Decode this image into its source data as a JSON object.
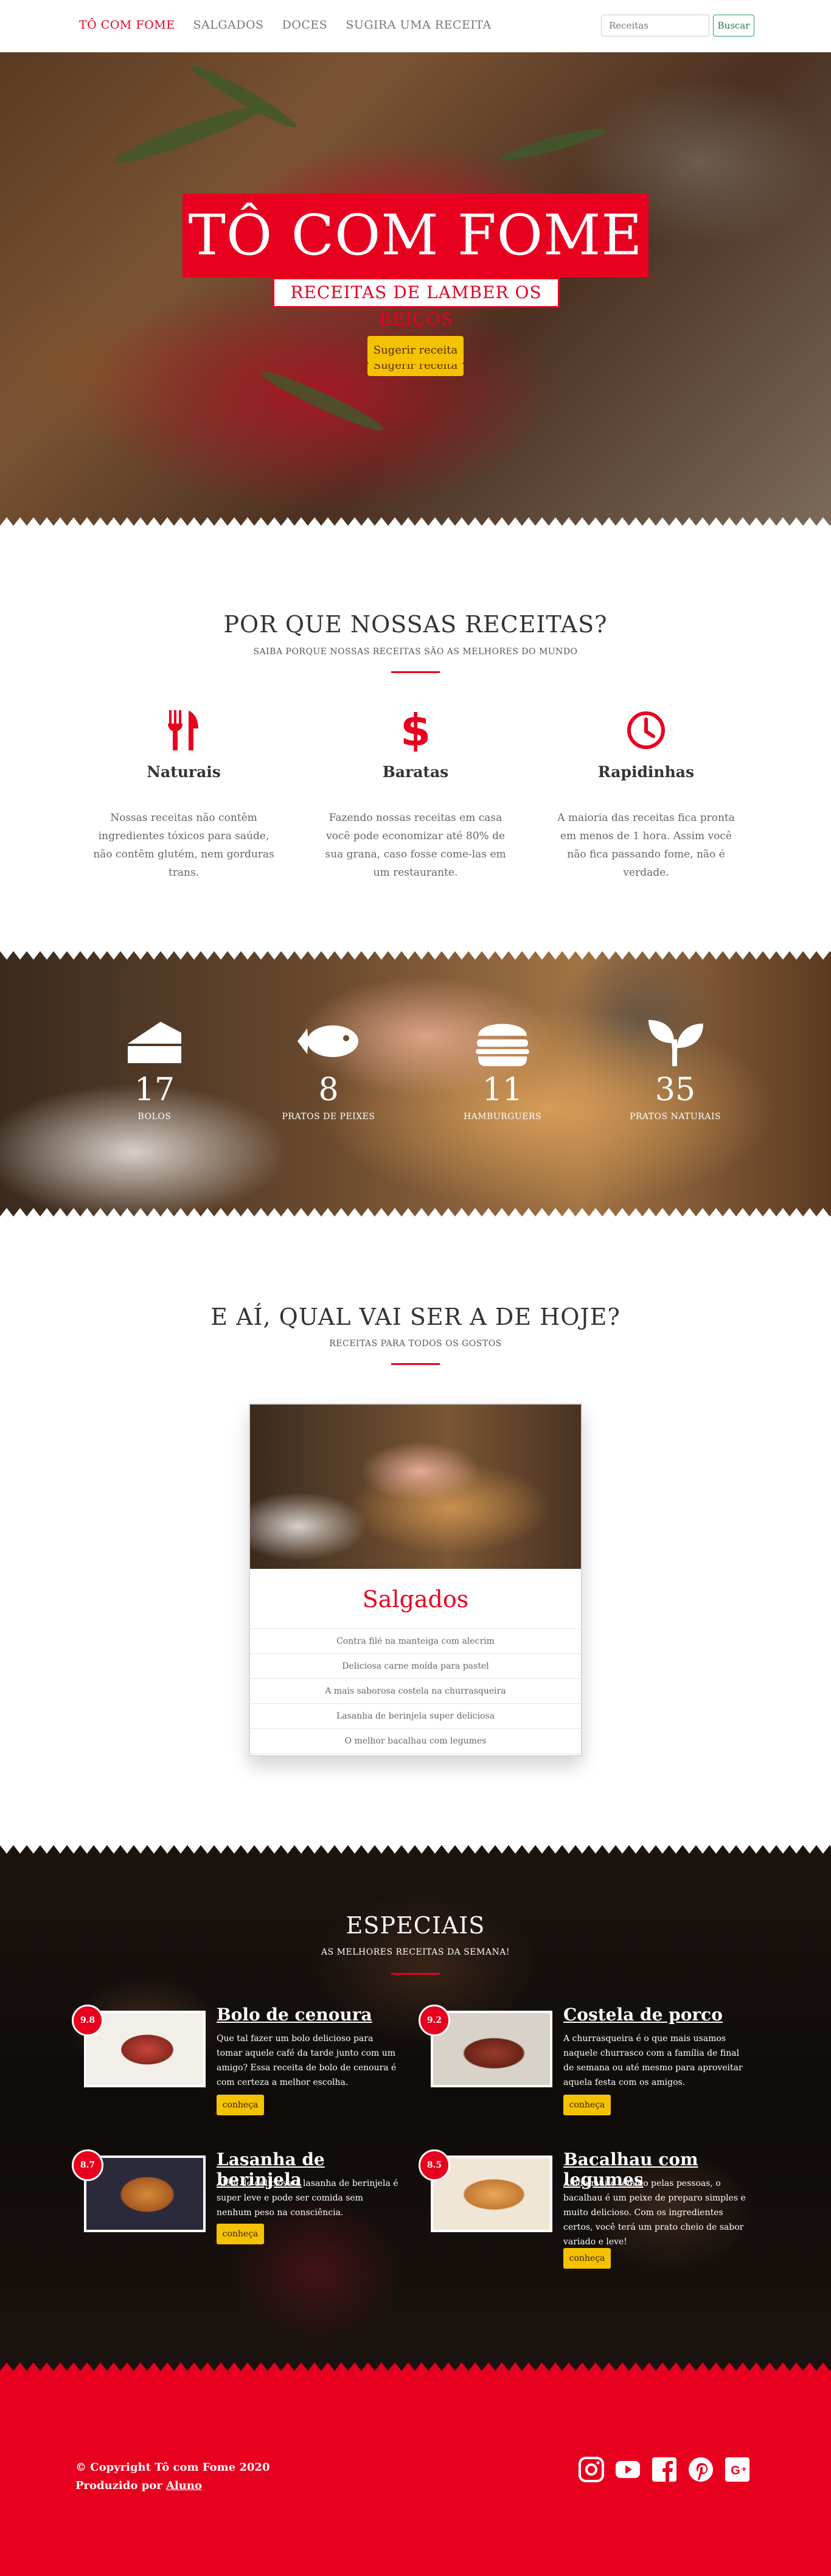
{
  "nav": {
    "brand": "TÔ COM FOME",
    "links": [
      "SALGADOS",
      "DOCES",
      "SUGIRA UMA RECEITA"
    ],
    "search_placeholder": "Receitas",
    "search_button": "Buscar"
  },
  "hero": {
    "title": "TÔ COM FOME",
    "subtitle": "RECEITAS DE LAMBER OS BEIÇOS",
    "cta": "Sugerir receita",
    "cta_ghost": "Sugerir receita"
  },
  "why": {
    "title": "POR QUE NOSSAS RECEITAS?",
    "subtitle": "SAIBA PORQUE NOSSAS RECEITAS SÃO AS MELHORES DO MUNDO",
    "features": [
      {
        "icon": "utensils-icon",
        "title": "Naturais",
        "text": "Nossas receitas não contêm ingredientes tóxicos para saúde, não contêm glutém, nem gorduras trans."
      },
      {
        "icon": "dollar-icon",
        "title": "Baratas",
        "text": "Fazendo nossas receitas em casa você pode economizar até 80% de sua grana, caso fosse come-las em um restaurante."
      },
      {
        "icon": "clock-icon",
        "title": "Rapidinhas",
        "text": "A maioria das receitas fica pronta em menos de 1 hora. Assim você não fica passando fome, não é verdade."
      }
    ]
  },
  "stats": [
    {
      "icon": "cake-icon",
      "number": "17",
      "label": "BOLOS"
    },
    {
      "icon": "fish-icon",
      "number": "8",
      "label": "PRATOS DE PEIXES"
    },
    {
      "icon": "burger-icon",
      "number": "11",
      "label": "HAMBURGUERS"
    },
    {
      "icon": "leaf-icon",
      "number": "35",
      "label": "PRATOS NATURAIS"
    }
  ],
  "today": {
    "title": "E AÍ, QUAL VAI SER A DE HOJE?",
    "subtitle": "RECEITAS PARA TODOS OS GOSTOS",
    "card": {
      "title": "Salgados",
      "items": [
        "Contra filé na manteiga com alecrim",
        "Deliciosa carne moída para pastel",
        "A mais saborosa costela na churrasqueira",
        "Lasanha de berinjela super deliciosa",
        "O melhor bacalhau com legumes"
      ]
    }
  },
  "especiais": {
    "title": "ESPECIAIS",
    "subtitle": "AS MELHORES RECEITAS DA SEMANA!",
    "button_label": "conheça",
    "items": [
      {
        "rating": "9.8",
        "title": "Bolo de cenoura",
        "text": "Que tal fazer um bolo delicioso para tomar aquele café da tarde junto com um amigo? Essa receita de bolo de cenoura é com certeza a melhor escolha."
      },
      {
        "rating": "9.2",
        "title": "Costela de porco",
        "text": "A churrasqueira é o que mais usamos naquele churrasco com a família de final de semana ou até mesmo para aproveitar aquela festa com os amigos."
      },
      {
        "rating": "8.7",
        "title": "Lasanha de berinjela",
        "text": "Além de deliciosa a lasanha de berinjela é super leve e pode ser comida sem nenhum peso na consciência."
      },
      {
        "rating": "8.5",
        "title": "Bacalhau com legumes",
        "text": "Ainda muito temido pelas pessoas, o bacalhau é um peixe de preparo simples e muito delicioso. Com os ingredientes certos, você terá um prato cheio de sabor variado e leve!"
      }
    ]
  },
  "footer": {
    "copyright": "© Copyright Tô com Fome 2020",
    "produced_by": "Produzido por ",
    "author": "Aluno",
    "socials": [
      "instagram-icon",
      "youtube-icon",
      "facebook-icon",
      "pinterest-icon",
      "google-plus-icon"
    ]
  },
  "colors": {
    "accent": "#e8001f",
    "button": "#f4c200"
  }
}
